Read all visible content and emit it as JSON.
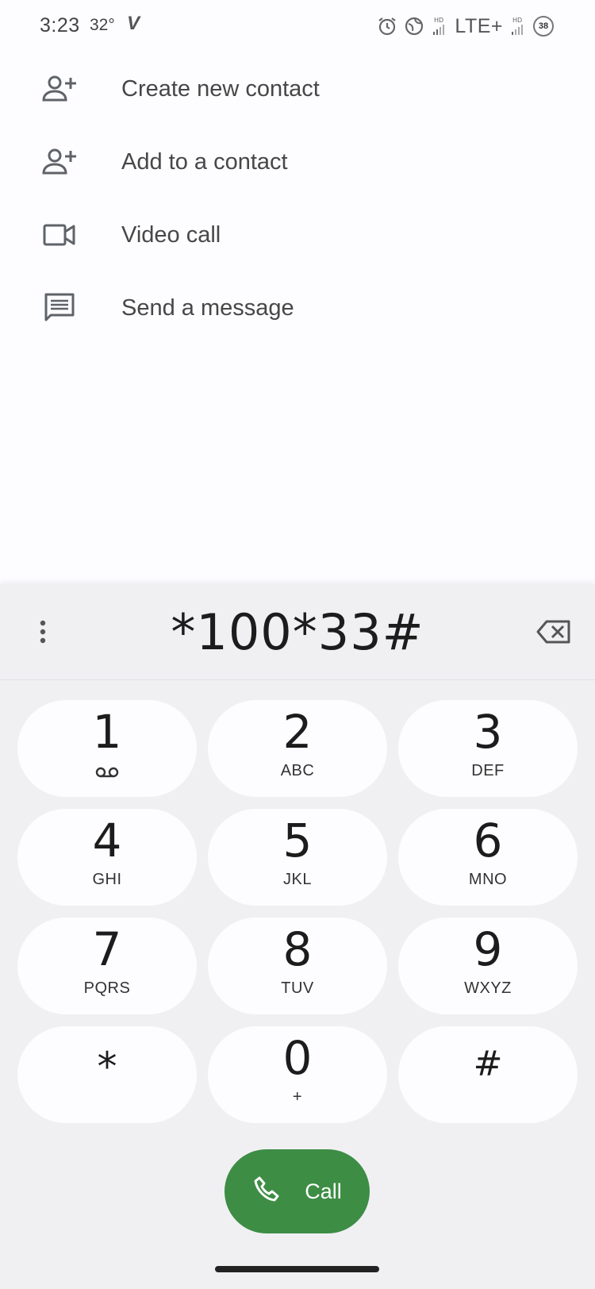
{
  "status_bar": {
    "time": "3:23",
    "temperature": "32°",
    "network": "LTE+",
    "battery": "38"
  },
  "options": [
    {
      "label": "Create new contact",
      "icon": "person-add-icon"
    },
    {
      "label": "Add to a contact",
      "icon": "person-add-icon"
    },
    {
      "label": "Video call",
      "icon": "video-icon"
    },
    {
      "label": "Send a message",
      "icon": "message-icon"
    }
  ],
  "dialer": {
    "entered_number": "*100*33#",
    "keys": [
      {
        "digit": "1",
        "letters": ""
      },
      {
        "digit": "2",
        "letters": "ABC"
      },
      {
        "digit": "3",
        "letters": "DEF"
      },
      {
        "digit": "4",
        "letters": "GHI"
      },
      {
        "digit": "5",
        "letters": "JKL"
      },
      {
        "digit": "6",
        "letters": "MNO"
      },
      {
        "digit": "7",
        "letters": "PQRS"
      },
      {
        "digit": "8",
        "letters": "TUV"
      },
      {
        "digit": "9",
        "letters": "WXYZ"
      },
      {
        "digit": "*",
        "letters": ""
      },
      {
        "digit": "0",
        "letters": "+"
      },
      {
        "digit": "#",
        "letters": ""
      }
    ],
    "call_label": "Call"
  },
  "colors": {
    "call_button": "#3d8d45",
    "key_background": "#fdfcff",
    "dialer_background": "#f0f0f3"
  }
}
